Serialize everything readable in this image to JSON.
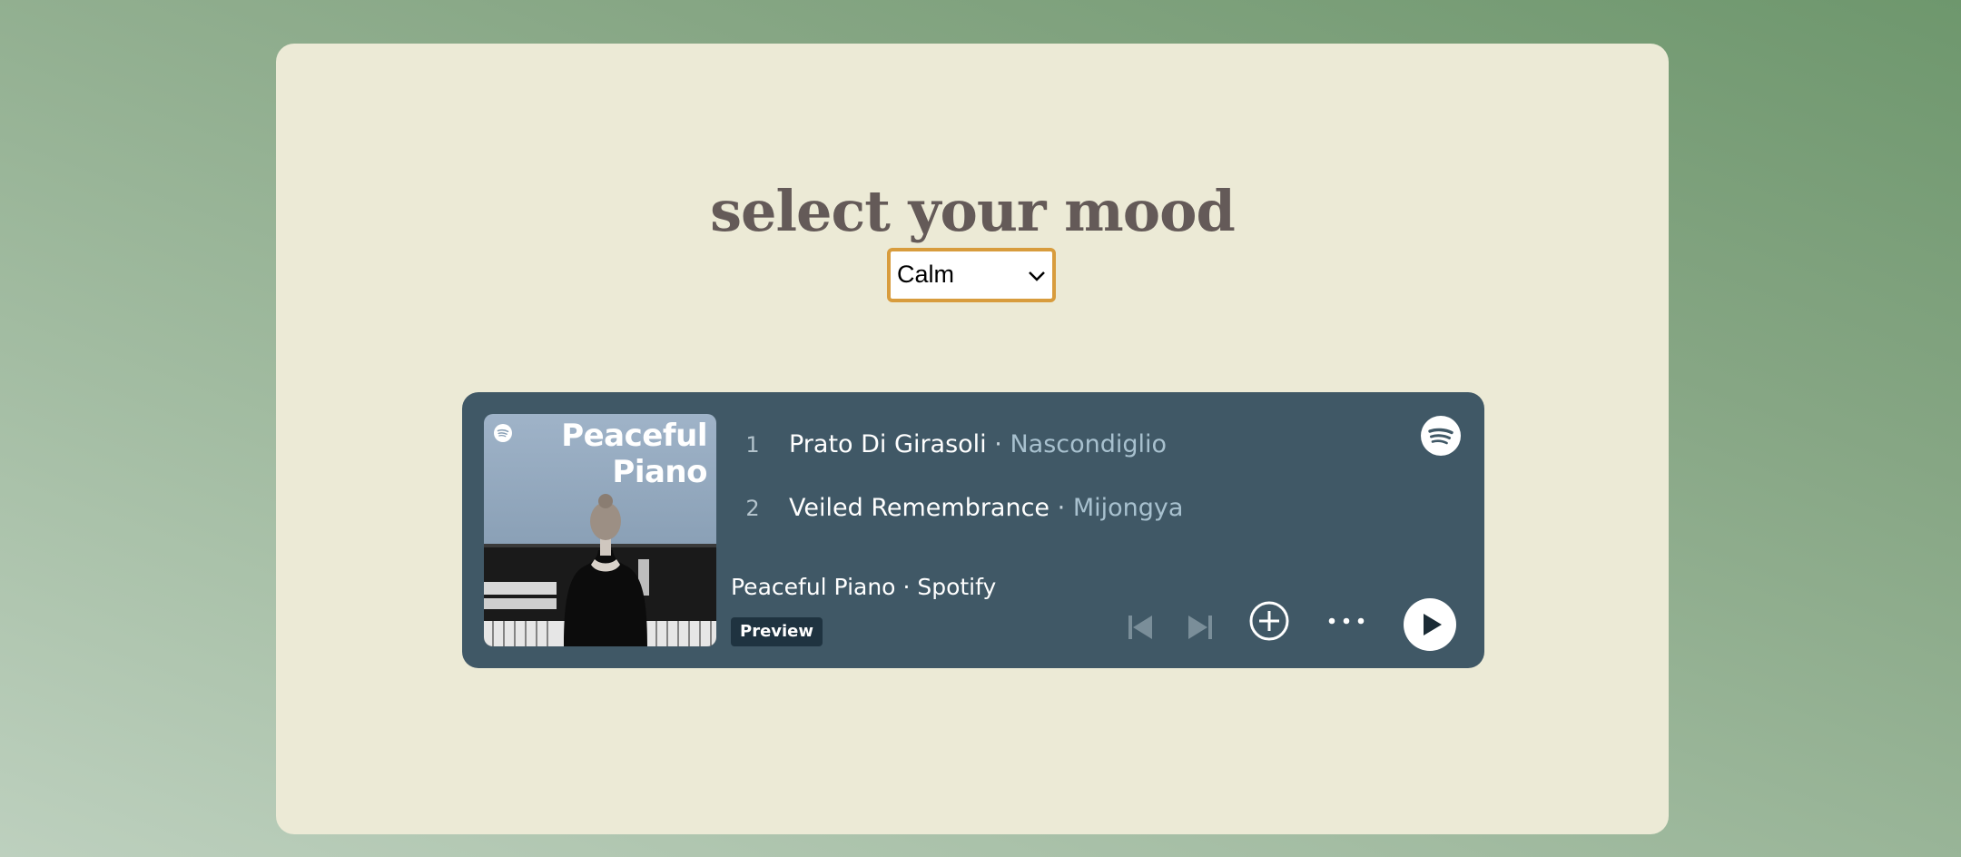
{
  "page": {
    "title": "select your mood",
    "mood_select": {
      "value": "Calm"
    }
  },
  "player": {
    "cover_title_line1": "Peaceful",
    "cover_title_line2": "Piano",
    "tracks": [
      {
        "number": "1",
        "title": "Prato Di Girasoli",
        "artist": "Nascondiglio"
      },
      {
        "number": "2",
        "title": "Veiled Remembrance",
        "artist": "Mijongya"
      }
    ],
    "playlist_name": "Peaceful Piano",
    "owner": "Spotify",
    "separator": "·",
    "badge": "Preview",
    "icons": [
      "spotify-icon",
      "previous-icon",
      "next-icon",
      "add-icon",
      "more-icon",
      "play-icon"
    ],
    "colors": {
      "background": "#405866",
      "accent_select": "#d89c3d",
      "card": "#ecead6"
    }
  }
}
